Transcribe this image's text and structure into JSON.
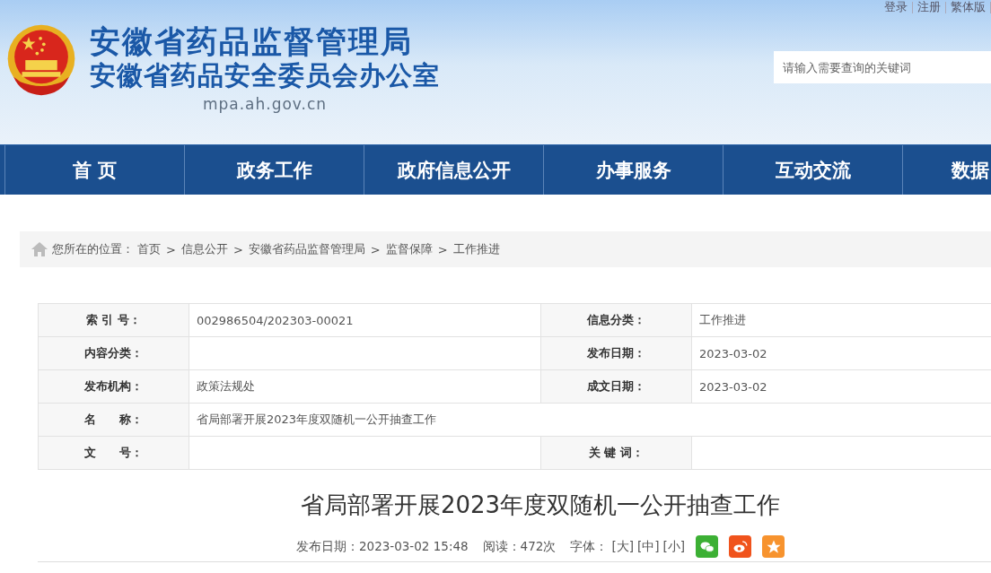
{
  "header": {
    "title": "安徽省药品监督管理局",
    "subtitle": "安徽省药品安全委员会办公室",
    "domain": "mpa.ah.gov.cn",
    "top_links": [
      "登录",
      "注册",
      "繁体版"
    ],
    "search": {
      "placeholder": "请输入需要查询的关键词"
    }
  },
  "nav": [
    {
      "label": "首 页"
    },
    {
      "label": "政务工作"
    },
    {
      "label": "政府信息公开"
    },
    {
      "label": "办事服务"
    },
    {
      "label": "互动交流"
    },
    {
      "label": "数据"
    }
  ],
  "breadcrumb": {
    "prefix": "您所在的位置：",
    "items": [
      "首页",
      "信息公开",
      "安徽省药品监督管理局",
      "监督保障",
      "工作推进"
    ],
    "separator": ">"
  },
  "info_table": {
    "rows": [
      [
        {
          "label": "索 引 号：",
          "value": "002986504/202303-00021"
        },
        {
          "label": "信息分类：",
          "value": "工作推进"
        }
      ],
      [
        {
          "label": "内容分类："
        },
        {
          "label": "发布日期：",
          "value": "2023-03-02"
        }
      ],
      [
        {
          "label": "发布机构：",
          "value": "政策法规处"
        },
        {
          "label": "成文日期：",
          "value": "2023-03-02"
        }
      ],
      [
        {
          "label": "名　　称：",
          "value": "省局部署开展2023年度双随机一公开抽查工作"
        }
      ],
      [
        {
          "label": "文　　号："
        },
        {
          "label": "关 键 词："
        }
      ]
    ]
  },
  "article": {
    "title": "省局部署开展2023年度双随机一公开抽查工作",
    "published": "发布日期：2023-03-02 15:48",
    "reads": "阅读：472次",
    "font_label": "字体：",
    "font_sizes": [
      "[大]",
      "[中]",
      "[小]"
    ],
    "share": [
      {
        "kind": "wechat"
      },
      {
        "kind": "weibo"
      },
      {
        "kind": "favorite"
      }
    ]
  }
}
